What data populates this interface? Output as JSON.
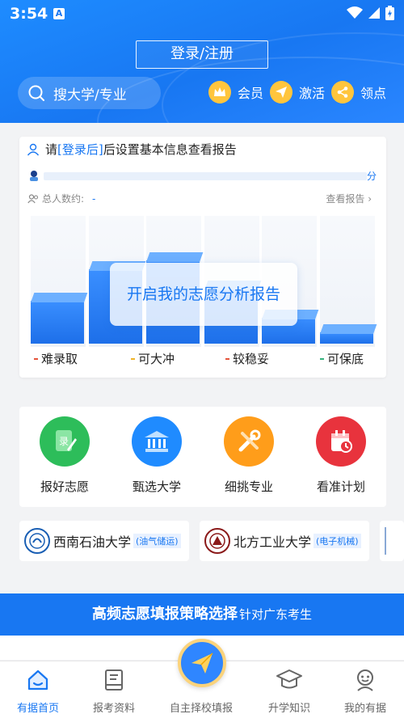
{
  "status_bar": {
    "time": "3:54",
    "a_badge": "A"
  },
  "header": {
    "login_label": "登录/注册",
    "search_label": "搜大学/专业",
    "quick_links": [
      {
        "label": "会员",
        "icon": "crown-icon"
      },
      {
        "label": "激活",
        "icon": "paper-plane-icon"
      },
      {
        "label": "领点",
        "icon": "share-icon"
      }
    ]
  },
  "report": {
    "notice_prefix": "请",
    "notice_link": "[登录后]",
    "notice_suffix": "后设置基本信息查看报告",
    "score_unit": "分",
    "score_fill": 0.0,
    "total_label": "总人数约:",
    "total_value": "-",
    "view_report": "查看报告",
    "overlay_text": "开启我的志愿分析报告",
    "legend": [
      {
        "label": "难录取",
        "color": "#e5533a"
      },
      {
        "label": "可大冲",
        "color": "#f0b429"
      },
      {
        "label": "较稳妥",
        "color": "#e5533a"
      },
      {
        "label": "可保底",
        "color": "#36b37e"
      }
    ],
    "bar_levels": [
      0.42,
      0.68,
      0.75,
      0.52,
      0.28,
      0.16
    ]
  },
  "features": [
    {
      "label": "报好志愿",
      "icon": "record-edit-icon",
      "color": "#2dbd5a"
    },
    {
      "label": "甄选大学",
      "icon": "university-building-icon",
      "color": "#1f8bff"
    },
    {
      "label": "细挑专业",
      "icon": "tools-icon",
      "color": "#ff9d1a"
    },
    {
      "label": "看准计划",
      "icon": "calendar-clock-icon",
      "color": "#e8333d"
    }
  ],
  "universities": [
    {
      "name": "西南石油大学",
      "tag": "(油气储运)",
      "logo_color": "#1a5fb4"
    },
    {
      "name": "北方工业大学",
      "tag": "(电子机械)",
      "logo_color": "#8b1a1a"
    }
  ],
  "banner": {
    "main": "高频志愿填报策略选择",
    "sub": "针对广东考生"
  },
  "nav": [
    {
      "label": "有据首页",
      "icon": "home-icon",
      "active": true
    },
    {
      "label": "报考资料",
      "icon": "book-icon",
      "active": false
    },
    {
      "label": "自主择校填报",
      "icon": "paper-plane-icon",
      "active": false
    },
    {
      "label": "升学知识",
      "icon": "graduation-cap-icon",
      "active": false
    },
    {
      "label": "我的有据",
      "icon": "profile-icon",
      "active": false
    }
  ]
}
